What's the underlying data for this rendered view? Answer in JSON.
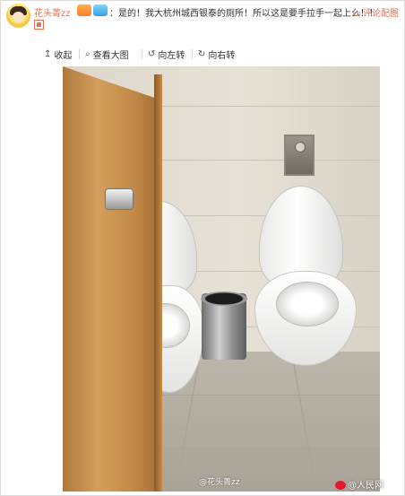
{
  "post": {
    "username": "花头菁zz",
    "comment": "是的！我大杭州城西银泰的厕所！所以这是要手拉手一起上么！！",
    "reply_label": "评论配图",
    "separator": "："
  },
  "toolbar": {
    "collapse": "收起",
    "view_large": "查看大图",
    "rotate_left": "向左转",
    "rotate_right": "向右转"
  },
  "icons": {
    "collapse": "arrow-up-icon",
    "view_large": "magnifier-icon",
    "rotate_left": "rotate-left-icon",
    "rotate_right": "rotate-right-icon",
    "reply": "comment-icon"
  },
  "image": {
    "watermark_user": "@花头菁zz",
    "site_watermark": "@人民网"
  },
  "colors": {
    "accent": "#eb7350"
  }
}
